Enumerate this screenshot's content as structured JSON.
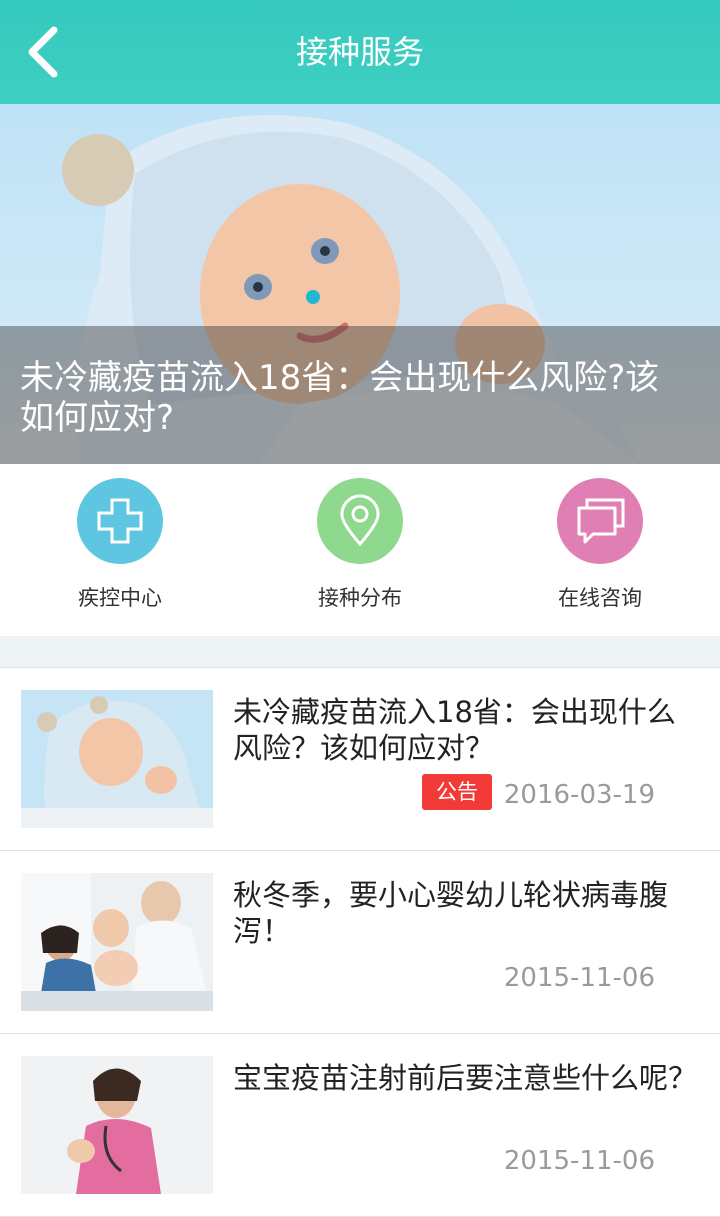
{
  "header": {
    "title": "接种服务",
    "back_icon": "chevron-left-icon"
  },
  "banner": {
    "caption": "未冷藏疫苗流入18省：会出现什么风险?该如何应对?",
    "image": "baby-in-hooded-towel"
  },
  "services": [
    {
      "label": "疾控中心",
      "icon": "medical-cross-icon",
      "color": "#5fc6e2"
    },
    {
      "label": "接种分布",
      "icon": "location-pin-icon",
      "color": "#8fd98f"
    },
    {
      "label": "在线咨询",
      "icon": "chat-bubbles-icon",
      "color": "#e07fb4"
    }
  ],
  "news": [
    {
      "title": "未冷藏疫苗流入18省：会出现什么风险？该如何应对？",
      "tag": "公告",
      "date": "2016-03-19",
      "thumb": "baby-towel"
    },
    {
      "title": "秋冬季，要小心婴幼儿轮状病毒腹泻！",
      "tag": "",
      "date": "2015-11-06",
      "thumb": "doctor-baby"
    },
    {
      "title": "宝宝疫苗注射前后要注意些什么呢？",
      "tag": "",
      "date": "2015-11-06",
      "thumb": "nurse-baby"
    }
  ]
}
